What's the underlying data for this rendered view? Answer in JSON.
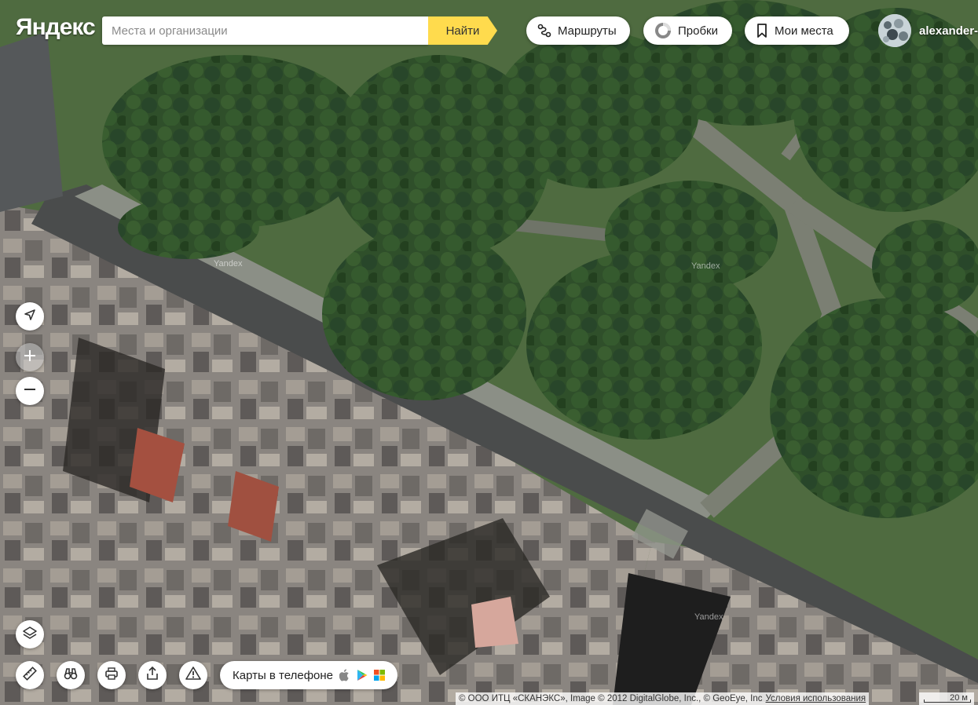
{
  "header": {
    "logo": "Яндекс",
    "search_placeholder": "Места и организации",
    "search_value": "",
    "find_label": "Найти",
    "routes_label": "Маршруты",
    "traffic_label": "Пробки",
    "my_places_label": "Мои места",
    "username": "alexander-c"
  },
  "apps_promo": {
    "label": "Карты в телефоне"
  },
  "footer": {
    "copyright": "© ООО ИТЦ «СКАНЭКС», Image © 2012 DigitalGlobe, Inc., © GeoEye, Inc",
    "terms_link": "Условия использования",
    "scale_label": "20 м"
  },
  "watermark": "Yandex",
  "icons": {
    "routes": "routes-icon",
    "traffic": "traffic-icon",
    "bookmark": "bookmark-icon",
    "locate": "locate-icon",
    "zoom_in": "zoom-in-icon",
    "zoom_out": "zoom-out-icon",
    "layers": "layers-icon",
    "ruler": "ruler-icon",
    "panorama": "binoculars-icon",
    "print": "print-icon",
    "share": "share-icon",
    "report": "warning-icon"
  },
  "colors": {
    "find_button": "#ffdb4d",
    "foliage": "#2b4a25",
    "grass": "#5d7a4a",
    "road": "#4a4c4c"
  }
}
